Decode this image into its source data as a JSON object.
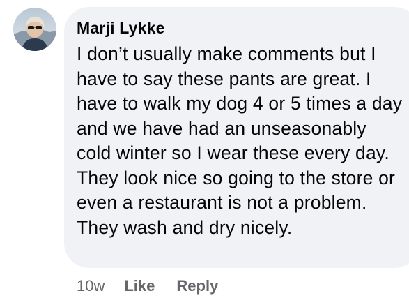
{
  "comment": {
    "author": "Marji Lykke",
    "text": "I don’t usually make comments but I have to say these pants are great. I have to walk my dog 4 or 5 times a day and we have had an unseasonably cold winter so I wear these every day. They look nice so going to the store or even a restaurant is not a problem. They wash and dry nicely.",
    "avatar_icon": "profile-photo-icon"
  },
  "actions": {
    "time": "10w",
    "like_label": "Like",
    "reply_label": "Reply"
  }
}
